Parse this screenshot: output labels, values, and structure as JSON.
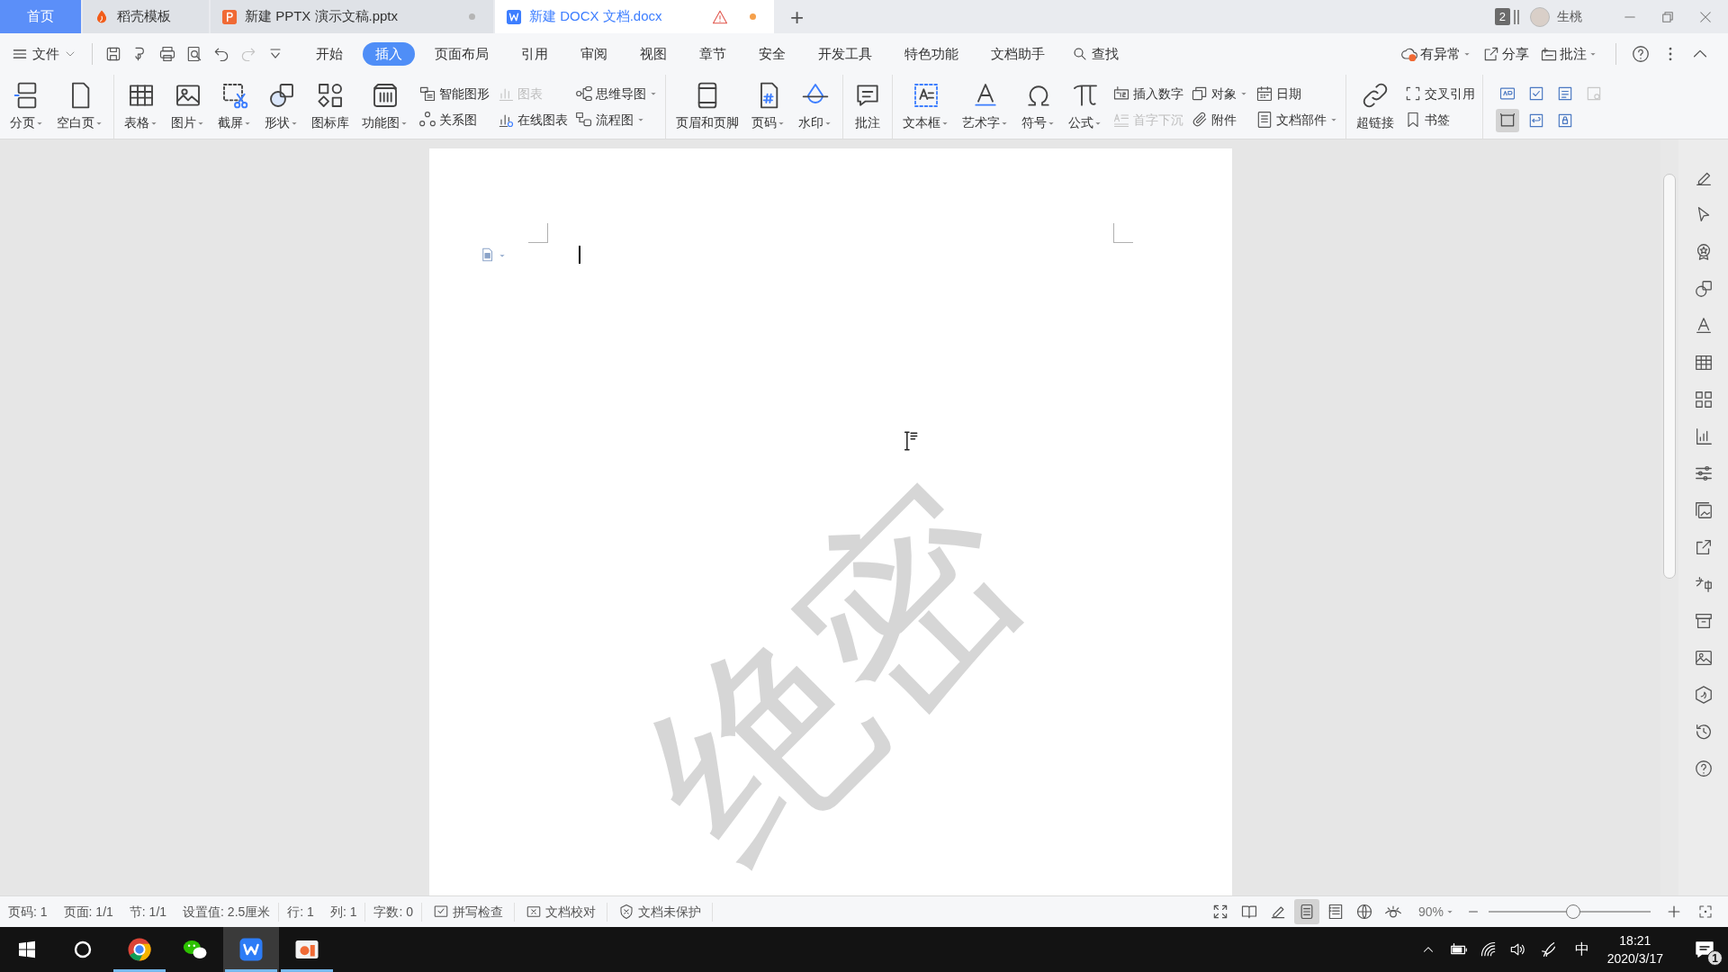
{
  "tabs": [
    {
      "label": "首页",
      "kind": "home",
      "selected": false,
      "unsaved": false,
      "warning": false
    },
    {
      "label": "稻壳模板",
      "kind": "docer",
      "selected": false,
      "unsaved": false,
      "warning": false
    },
    {
      "label": "新建 PPTX 演示文稿.pptx",
      "kind": "pptx",
      "selected": false,
      "unsaved": true,
      "warning": false
    },
    {
      "label": "新建 DOCX 文档.docx",
      "kind": "docx",
      "selected": true,
      "unsaved": true,
      "warning": true
    }
  ],
  "new_tab": "+",
  "account": {
    "count": "2",
    "user": "生桃"
  },
  "menu": {
    "file": "文件",
    "quick_access": [
      {
        "disabled": false
      },
      {
        "disabled": false
      },
      {
        "disabled": false
      },
      {
        "disabled": false
      },
      {
        "disabled": false
      },
      {
        "disabled": true
      },
      {
        "disabled": false
      }
    ],
    "items": [
      {
        "label": "开始",
        "selected": false
      },
      {
        "label": "插入",
        "selected": true
      },
      {
        "label": "页面布局",
        "selected": false
      },
      {
        "label": "引用",
        "selected": false
      },
      {
        "label": "审阅",
        "selected": false
      },
      {
        "label": "视图",
        "selected": false
      },
      {
        "label": "章节",
        "selected": false
      },
      {
        "label": "安全",
        "selected": false
      },
      {
        "label": "开发工具",
        "selected": false
      },
      {
        "label": "特色功能",
        "selected": false
      },
      {
        "label": "文档助手",
        "selected": false
      }
    ],
    "search": "查找",
    "actions": [
      {
        "label": "有异常",
        "dropdown": true
      },
      {
        "label": "分享",
        "dropdown": false
      },
      {
        "label": "批注",
        "dropdown": true
      }
    ]
  },
  "ribbon": [
    {
      "columns": [
        {
          "kind": "large",
          "label": "分页",
          "dropdown": true
        },
        {
          "kind": "large",
          "label": "空白页",
          "dropdown": true
        }
      ]
    },
    {
      "columns": [
        {
          "kind": "large",
          "label": "表格",
          "dropdown": true
        },
        {
          "kind": "large",
          "label": "图片",
          "dropdown": true
        },
        {
          "kind": "large",
          "label": "截屏",
          "dropdown": true
        },
        {
          "kind": "large",
          "label": "形状",
          "dropdown": true
        },
        {
          "kind": "large",
          "label": "图标库",
          "dropdown": false
        },
        {
          "kind": "large",
          "label": "功能图",
          "dropdown": true
        },
        {
          "kind": "pair",
          "items": [
            {
              "label": "智能图形",
              "dropdown": false,
              "disabled": false
            },
            {
              "label": "关系图",
              "dropdown": false,
              "disabled": false
            }
          ]
        },
        {
          "kind": "pair",
          "items": [
            {
              "label": "图表",
              "dropdown": false,
              "disabled": true
            },
            {
              "label": "在线图表",
              "dropdown": false,
              "disabled": false
            }
          ]
        },
        {
          "kind": "pair",
          "items": [
            {
              "label": "思维导图",
              "dropdown": true,
              "disabled": false
            },
            {
              "label": "流程图",
              "dropdown": true,
              "disabled": false
            }
          ]
        }
      ]
    },
    {
      "columns": [
        {
          "kind": "large",
          "label": "页眉和页脚",
          "dropdown": false
        },
        {
          "kind": "large",
          "label": "页码",
          "dropdown": true
        },
        {
          "kind": "large",
          "label": "水印",
          "dropdown": true
        }
      ]
    },
    {
      "columns": [
        {
          "kind": "large",
          "label": "批注",
          "dropdown": false
        }
      ]
    },
    {
      "columns": [
        {
          "kind": "large",
          "label": "文本框",
          "dropdown": true
        },
        {
          "kind": "large",
          "label": "艺术字",
          "dropdown": true
        },
        {
          "kind": "large",
          "label": "符号",
          "dropdown": true
        },
        {
          "kind": "large",
          "label": "公式",
          "dropdown": true
        },
        {
          "kind": "pair",
          "items": [
            {
              "label": "插入数字",
              "dropdown": false,
              "disabled": false
            },
            {
              "label": "首字下沉",
              "dropdown": false,
              "disabled": true
            }
          ]
        },
        {
          "kind": "pair",
          "items": [
            {
              "label": "对象",
              "dropdown": true,
              "disabled": false
            },
            {
              "label": "附件",
              "dropdown": false,
              "disabled": false
            }
          ]
        },
        {
          "kind": "pair",
          "items": [
            {
              "label": "日期",
              "dropdown": false,
              "disabled": false
            },
            {
              "label": "文档部件",
              "dropdown": true,
              "disabled": false
            }
          ]
        }
      ]
    },
    {
      "columns": [
        {
          "kind": "large",
          "label": "超链接",
          "dropdown": false
        },
        {
          "kind": "pair",
          "items": [
            {
              "label": "交叉引用",
              "dropdown": false,
              "disabled": false
            },
            {
              "label": "书签",
              "dropdown": false,
              "disabled": false
            }
          ]
        }
      ]
    },
    {
      "columns": [
        {
          "kind": "grid",
          "items": [
            {
              "selected": false,
              "disabled": false
            },
            {
              "selected": false,
              "disabled": false
            },
            {
              "selected": false,
              "disabled": false
            },
            {
              "selected": false,
              "disabled": true
            },
            {
              "selected": true,
              "disabled": false
            },
            {
              "selected": false,
              "disabled": false
            },
            {
              "selected": false,
              "disabled": false
            }
          ]
        }
      ]
    }
  ],
  "document": {
    "watermark": "绝密"
  },
  "status_bar": {
    "fields": [
      "页码: 1",
      "页面: 1/1",
      "节: 1/1",
      "设置值: 2.5厘米",
      "行: 1",
      "列: 1",
      "字数: 0"
    ],
    "tools": [
      "拼写检查",
      "文档校对",
      "文档未保护"
    ],
    "views": [
      {
        "selected": false
      },
      {
        "selected": false
      },
      {
        "selected": false
      },
      {
        "selected": true
      },
      {
        "selected": false
      },
      {
        "selected": false
      },
      {
        "selected": false
      }
    ],
    "zoom": "90%",
    "zoom_slider": {
      "level": 0.52
    }
  },
  "taskbar": {
    "apps": [
      {
        "kind": "browser",
        "running": true,
        "active": false
      },
      {
        "kind": "chat",
        "running": false,
        "active": false
      },
      {
        "kind": "writer",
        "running": true,
        "active": true
      },
      {
        "kind": "slides",
        "running": true,
        "active": false
      }
    ],
    "ime": "中",
    "time": "18:21",
    "date": "2020/3/17",
    "notifications": "1"
  }
}
